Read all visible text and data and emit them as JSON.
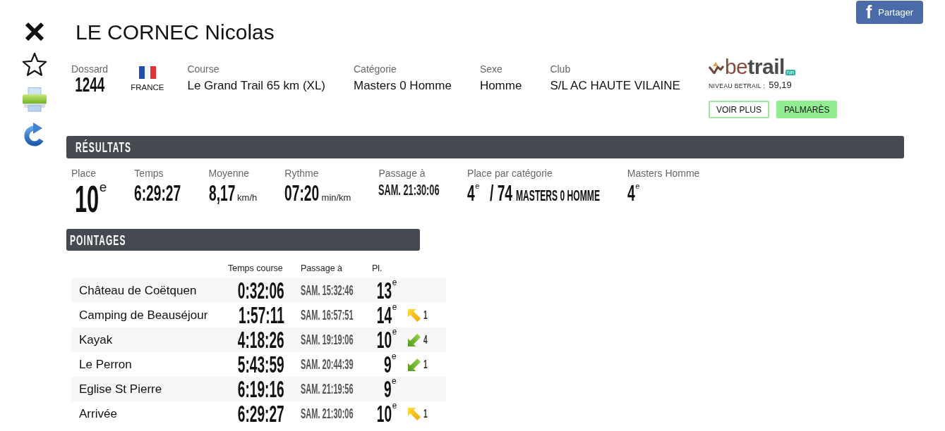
{
  "share_button": {
    "glyph": "f",
    "label": "Partager"
  },
  "athlete": {
    "name": "LE CORNEC Nicolas"
  },
  "info": {
    "bib": {
      "label": "Dossard",
      "value": "1244"
    },
    "country": "FRANCE",
    "fields": [
      {
        "label": "Course",
        "value": "Le Grand Trail 65 km (XL)"
      },
      {
        "label": "Catégorie",
        "value": "Masters 0 Homme"
      },
      {
        "label": "Sexe",
        "value": "Homme"
      },
      {
        "label": "Club",
        "value": "S/L AC HAUTE VILAINE"
      }
    ]
  },
  "betrail": {
    "logo": "be**trail**",
    "logo_badge": "run",
    "rating_label": "NIVEAU BETRAIL :",
    "rating": "59,19",
    "buttons": [
      {
        "label": "VOIR PLUS",
        "kind": "outline"
      },
      {
        "label": "PALMARÈS",
        "kind": "filled"
      }
    ]
  },
  "results": {
    "title": "RÉSULTATS",
    "stats": [
      {
        "kind": "place",
        "label": "Place",
        "value": "10$^{e}$"
      },
      {
        "kind": "value",
        "label": "Temps",
        "value": "6:29:27"
      },
      {
        "kind": "value",
        "label": "Moyenne",
        "value": "8,17",
        "unit": "km/h"
      },
      {
        "kind": "value",
        "label": "Rythme",
        "value": "07:20",
        "unit": "min/km"
      },
      {
        "kind": "passage",
        "label": "Passage à",
        "value": "SAM. 21:30:06"
      },
      {
        "kind": "category",
        "label": "Place par catégorie",
        "value": "4$^{e}$",
        "total": "/ 74",
        "category": "MASTERS 0 HOMME"
      },
      {
        "kind": "value",
        "label": "Masters Homme",
        "value": "4$^{e}$"
      }
    ]
  },
  "checkpoints": {
    "title": "POINTAGES",
    "columns": [
      "Temps course",
      "Passage à",
      "Pl."
    ],
    "rows": [
      {
        "name": "Château de Coëtquen",
        "time": "0:32:06",
        "passage": "SAM. 15:32:46",
        "place": "13$^{e}$"
      },
      {
        "name": "Camping de Beauséjour",
        "time": "1:57:11",
        "passage": "SAM. 16:57:51",
        "place": "14$^{e}$",
        "movement": {
          "gained": false,
          "change": "1"
        }
      },
      {
        "name": "Kayak",
        "time": "4:18:26",
        "passage": "SAM. 19:19:06",
        "place": "10$^{e}$",
        "movement": {
          "gained": true,
          "change": "4"
        }
      },
      {
        "name": "Le Perron",
        "time": "5:43:59",
        "passage": "SAM. 20:44:39",
        "place": "9$^{e}$",
        "movement": {
          "gained": true,
          "change": "1"
        }
      },
      {
        "name": "Eglise St Pierre",
        "time": "6:19:16",
        "passage": "SAM. 21:19:56",
        "place": "9$^{e}$"
      },
      {
        "name": "Arrivée",
        "time": "6:29:27",
        "passage": "SAM. 21:30:06",
        "place": "10$^{e}$",
        "movement": {
          "gained": false,
          "change": "1"
        }
      }
    ]
  }
}
